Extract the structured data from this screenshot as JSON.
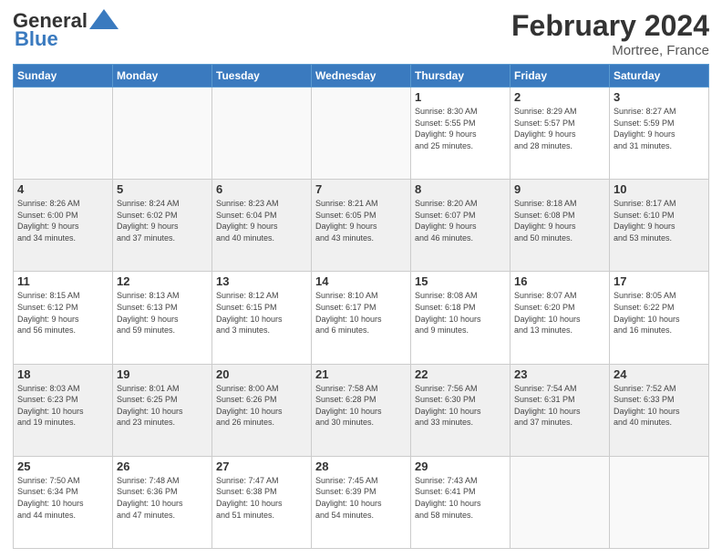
{
  "header": {
    "logo_general": "General",
    "logo_blue": "Blue",
    "month_year": "February 2024",
    "location": "Mortree, France"
  },
  "weekdays": [
    "Sunday",
    "Monday",
    "Tuesday",
    "Wednesday",
    "Thursday",
    "Friday",
    "Saturday"
  ],
  "weeks": [
    [
      {
        "day": "",
        "info": ""
      },
      {
        "day": "",
        "info": ""
      },
      {
        "day": "",
        "info": ""
      },
      {
        "day": "",
        "info": ""
      },
      {
        "day": "1",
        "info": "Sunrise: 8:30 AM\nSunset: 5:55 PM\nDaylight: 9 hours\nand 25 minutes."
      },
      {
        "day": "2",
        "info": "Sunrise: 8:29 AM\nSunset: 5:57 PM\nDaylight: 9 hours\nand 28 minutes."
      },
      {
        "day": "3",
        "info": "Sunrise: 8:27 AM\nSunset: 5:59 PM\nDaylight: 9 hours\nand 31 minutes."
      }
    ],
    [
      {
        "day": "4",
        "info": "Sunrise: 8:26 AM\nSunset: 6:00 PM\nDaylight: 9 hours\nand 34 minutes."
      },
      {
        "day": "5",
        "info": "Sunrise: 8:24 AM\nSunset: 6:02 PM\nDaylight: 9 hours\nand 37 minutes."
      },
      {
        "day": "6",
        "info": "Sunrise: 8:23 AM\nSunset: 6:04 PM\nDaylight: 9 hours\nand 40 minutes."
      },
      {
        "day": "7",
        "info": "Sunrise: 8:21 AM\nSunset: 6:05 PM\nDaylight: 9 hours\nand 43 minutes."
      },
      {
        "day": "8",
        "info": "Sunrise: 8:20 AM\nSunset: 6:07 PM\nDaylight: 9 hours\nand 46 minutes."
      },
      {
        "day": "9",
        "info": "Sunrise: 8:18 AM\nSunset: 6:08 PM\nDaylight: 9 hours\nand 50 minutes."
      },
      {
        "day": "10",
        "info": "Sunrise: 8:17 AM\nSunset: 6:10 PM\nDaylight: 9 hours\nand 53 minutes."
      }
    ],
    [
      {
        "day": "11",
        "info": "Sunrise: 8:15 AM\nSunset: 6:12 PM\nDaylight: 9 hours\nand 56 minutes."
      },
      {
        "day": "12",
        "info": "Sunrise: 8:13 AM\nSunset: 6:13 PM\nDaylight: 9 hours\nand 59 minutes."
      },
      {
        "day": "13",
        "info": "Sunrise: 8:12 AM\nSunset: 6:15 PM\nDaylight: 10 hours\nand 3 minutes."
      },
      {
        "day": "14",
        "info": "Sunrise: 8:10 AM\nSunset: 6:17 PM\nDaylight: 10 hours\nand 6 minutes."
      },
      {
        "day": "15",
        "info": "Sunrise: 8:08 AM\nSunset: 6:18 PM\nDaylight: 10 hours\nand 9 minutes."
      },
      {
        "day": "16",
        "info": "Sunrise: 8:07 AM\nSunset: 6:20 PM\nDaylight: 10 hours\nand 13 minutes."
      },
      {
        "day": "17",
        "info": "Sunrise: 8:05 AM\nSunset: 6:22 PM\nDaylight: 10 hours\nand 16 minutes."
      }
    ],
    [
      {
        "day": "18",
        "info": "Sunrise: 8:03 AM\nSunset: 6:23 PM\nDaylight: 10 hours\nand 19 minutes."
      },
      {
        "day": "19",
        "info": "Sunrise: 8:01 AM\nSunset: 6:25 PM\nDaylight: 10 hours\nand 23 minutes."
      },
      {
        "day": "20",
        "info": "Sunrise: 8:00 AM\nSunset: 6:26 PM\nDaylight: 10 hours\nand 26 minutes."
      },
      {
        "day": "21",
        "info": "Sunrise: 7:58 AM\nSunset: 6:28 PM\nDaylight: 10 hours\nand 30 minutes."
      },
      {
        "day": "22",
        "info": "Sunrise: 7:56 AM\nSunset: 6:30 PM\nDaylight: 10 hours\nand 33 minutes."
      },
      {
        "day": "23",
        "info": "Sunrise: 7:54 AM\nSunset: 6:31 PM\nDaylight: 10 hours\nand 37 minutes."
      },
      {
        "day": "24",
        "info": "Sunrise: 7:52 AM\nSunset: 6:33 PM\nDaylight: 10 hours\nand 40 minutes."
      }
    ],
    [
      {
        "day": "25",
        "info": "Sunrise: 7:50 AM\nSunset: 6:34 PM\nDaylight: 10 hours\nand 44 minutes."
      },
      {
        "day": "26",
        "info": "Sunrise: 7:48 AM\nSunset: 6:36 PM\nDaylight: 10 hours\nand 47 minutes."
      },
      {
        "day": "27",
        "info": "Sunrise: 7:47 AM\nSunset: 6:38 PM\nDaylight: 10 hours\nand 51 minutes."
      },
      {
        "day": "28",
        "info": "Sunrise: 7:45 AM\nSunset: 6:39 PM\nDaylight: 10 hours\nand 54 minutes."
      },
      {
        "day": "29",
        "info": "Sunrise: 7:43 AM\nSunset: 6:41 PM\nDaylight: 10 hours\nand 58 minutes."
      },
      {
        "day": "",
        "info": ""
      },
      {
        "day": "",
        "info": ""
      }
    ]
  ]
}
